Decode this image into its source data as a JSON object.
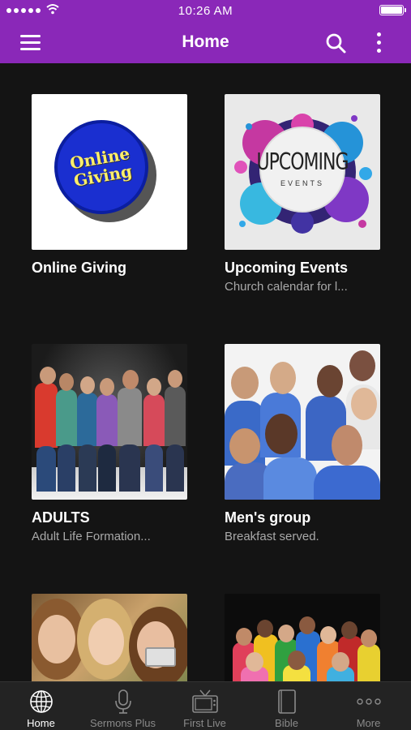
{
  "status_bar": {
    "time": "10:26 AM"
  },
  "app_bar": {
    "title": "Home"
  },
  "cards": [
    {
      "title": "Online Giving",
      "subtitle": "",
      "image_text": [
        "Online",
        "Giving"
      ]
    },
    {
      "title": "Upcoming Events",
      "subtitle": "Church calendar for l...",
      "image_text": [
        "UPCOMING",
        "EVENTS"
      ]
    },
    {
      "title": "ADULTS",
      "subtitle": "Adult Life Formation..."
    },
    {
      "title": "Men's group",
      "subtitle": "Breakfast served."
    },
    {
      "title": "",
      "subtitle": ""
    },
    {
      "title": "",
      "subtitle": ""
    }
  ],
  "tabs": [
    {
      "label": "Home",
      "icon": "globe-icon",
      "active": true
    },
    {
      "label": "Sermons Plus",
      "icon": "microphone-icon",
      "active": false
    },
    {
      "label": "First Live",
      "icon": "tv-icon",
      "active": false
    },
    {
      "label": "Bible",
      "icon": "book-icon",
      "active": false
    },
    {
      "label": "More",
      "icon": "ellipsis-icon",
      "active": false
    }
  ],
  "colors": {
    "app_bar": "#8a28b8",
    "background": "#141414",
    "tab_bar": "#232323",
    "subtitle": "#a9a9a9"
  }
}
